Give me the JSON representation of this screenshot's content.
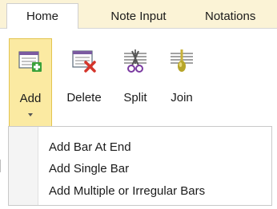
{
  "tabs": [
    {
      "label": "Home",
      "active": true
    },
    {
      "label": "Note Input",
      "active": false
    },
    {
      "label": "Notations",
      "active": false
    }
  ],
  "ribbon": {
    "buttons": [
      {
        "label": "Add",
        "icon": "add-bar-icon",
        "highlighted": true,
        "has_dropdown": true
      },
      {
        "label": "Delete",
        "icon": "delete-bar-icon"
      },
      {
        "label": "Split",
        "icon": "split-bar-icon"
      },
      {
        "label": "Join",
        "icon": "join-bar-icon"
      }
    ]
  },
  "menu": {
    "items": [
      {
        "label": "Add Bar At End"
      },
      {
        "label": "Add Single Bar"
      },
      {
        "label": "Add Multiple or Irregular Bars"
      }
    ]
  },
  "colors": {
    "tab_strip_bg": "#fbf3d6",
    "active_button_bg": "#fbeaa2",
    "active_button_border": "#e3c44f",
    "add_green": "#3aa13a",
    "delete_red": "#d4352b"
  }
}
